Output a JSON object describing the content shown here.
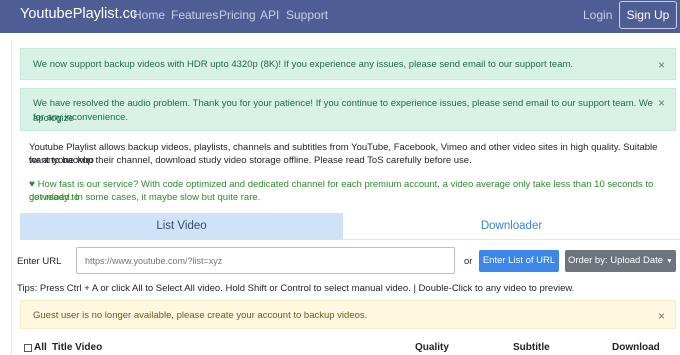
{
  "navbar": {
    "brand": "YoutubePlaylist.cc",
    "links": [
      "Home",
      "Features",
      "Pricing",
      "API",
      "Support"
    ],
    "login": "Login",
    "signup": "Sign Up"
  },
  "alerts": {
    "hdr": "We now support backup videos with HDR upto 4320p (8K)! If you experience any issues, please send email to our support team.",
    "audio_line1": "We have resolved the audio problem. Thank you for your patience! If you continue to experience issues, please send email to our support team. We apologize",
    "audio_line2": "for any inconvenience.",
    "guest": "Guest user is no longer available, please create your account to backup videos.",
    "close": "×"
  },
  "info": {
    "line1": "Youtube Playlist allows backup videos, playlists, channels and subtitles from YouTube, Facebook, Vimeo and other video sites in high quality. Suitable for anyone who",
    "line2": "want to backup their channel, download study video storage offline. Please read ToS carefully before use."
  },
  "speed": {
    "heart": "♥",
    "line1": " How fast is our service? With code optimized and dedicated channel for each premium account, a video average only take less than 10 seconds to get ready to",
    "line2": "download. In some cases, it maybe slow but quite rare."
  },
  "tabs": {
    "list_video": "List Video",
    "downloader": "Downloader"
  },
  "url_form": {
    "label": "Enter URL",
    "placeholder": "https://www.youtube.com/?list=xyz",
    "or": "or",
    "list_button": "Enter List of URL",
    "order_button": "Order by: Upload Date",
    "caret": "▼"
  },
  "tips": "Tips: Press Ctrl + A or click All to Select All video. Hold Shift or Control to select manual video. | Double-Click to any video to preview.",
  "table": {
    "all": "All",
    "title": "Title Video",
    "quality": "Quality",
    "subtitle": "Subtitle",
    "download": "Download"
  }
}
